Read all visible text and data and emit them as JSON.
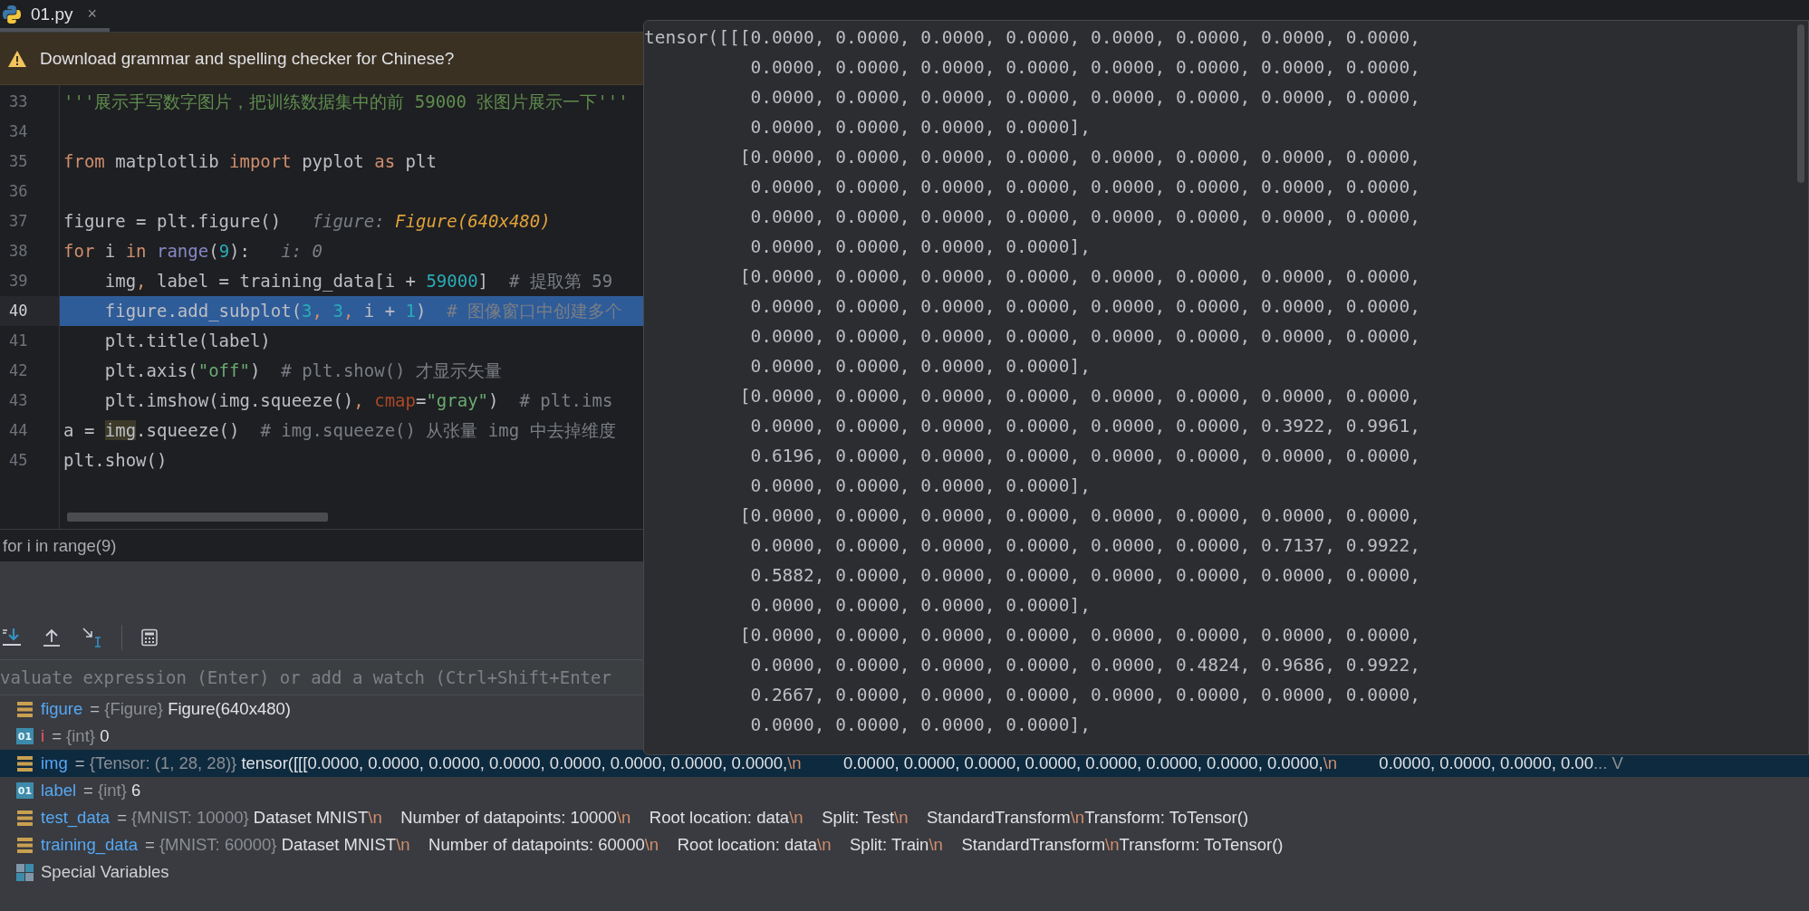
{
  "tab": {
    "title": "01.py",
    "close": "×",
    "selected": true
  },
  "banner": {
    "text": "Download grammar and spelling checker for Chinese?"
  },
  "editor": {
    "lines": [
      {
        "number": "33",
        "current": false,
        "tokens": [
          {
            "text": "'''展示手写数字图片，把训练数据集中的前 59000 张图片展示一下'''",
            "kind": "docstring"
          }
        ]
      },
      {
        "number": "34",
        "current": false
      },
      {
        "number": "35",
        "current": false,
        "tokens": [
          {
            "text": "from",
            "kind": "keyword"
          },
          {
            "text": " matplotlib ",
            "kind": "plain"
          },
          {
            "text": "import",
            "kind": "keyword"
          },
          {
            "text": " pyplot ",
            "kind": "plain"
          },
          {
            "text": "as",
            "kind": "keyword"
          },
          {
            "text": " plt",
            "kind": "plain"
          }
        ]
      },
      {
        "number": "36",
        "current": false
      },
      {
        "number": "37",
        "current": false,
        "tokens": [
          {
            "text": "figure = plt.figure()",
            "kind": "plain"
          },
          {
            "text": "   figure: ",
            "kind": "hint"
          },
          {
            "text": "Figure(640x480)",
            "kind": "hint_value"
          }
        ]
      },
      {
        "number": "38",
        "current": false,
        "tokens": [
          {
            "text": "for",
            "kind": "keyword"
          },
          {
            "text": " i ",
            "kind": "plain"
          },
          {
            "text": "in",
            "kind": "keyword"
          },
          {
            "text": " range",
            "kind": "builtin"
          },
          {
            "text": "(",
            "kind": "plain"
          },
          {
            "text": "9",
            "kind": "number"
          },
          {
            "text": "):",
            "kind": "plain"
          },
          {
            "text": "   i: 0",
            "kind": "hint"
          }
        ]
      },
      {
        "number": "39",
        "current": false,
        "tokens": [
          {
            "text": "    img",
            "kind": "plain"
          },
          {
            "text": ",",
            "kind": "keyword"
          },
          {
            "text": " label = training_data[i + ",
            "kind": "plain"
          },
          {
            "text": "59000",
            "kind": "number"
          },
          {
            "text": "]  ",
            "kind": "plain"
          },
          {
            "text": "# 提取第 59",
            "kind": "comment"
          }
        ]
      },
      {
        "number": "40",
        "current": true,
        "tokens": [
          {
            "text": "    figure.add_subplot(",
            "kind": "plain"
          },
          {
            "text": "3",
            "kind": "number"
          },
          {
            "text": ", ",
            "kind": "keyword"
          },
          {
            "text": "3",
            "kind": "number"
          },
          {
            "text": ",",
            "kind": "keyword"
          },
          {
            "text": " i + ",
            "kind": "plain"
          },
          {
            "text": "1",
            "kind": "number"
          },
          {
            "text": ")  ",
            "kind": "plain"
          },
          {
            "text": "# 图像窗口中创建多个",
            "kind": "comment"
          }
        ]
      },
      {
        "number": "41",
        "current": false,
        "tokens": [
          {
            "text": "    plt.title(label)",
            "kind": "plain"
          }
        ]
      },
      {
        "number": "42",
        "current": false,
        "tokens": [
          {
            "text": "    plt.axis(",
            "kind": "plain"
          },
          {
            "text": "\"off\"",
            "kind": "string"
          },
          {
            "text": ")  ",
            "kind": "plain"
          },
          {
            "text": "# plt.show() 才显示矢量",
            "kind": "comment"
          }
        ]
      },
      {
        "number": "43",
        "current": false,
        "tokens": [
          {
            "text": "    plt.imshow(img.squeeze()",
            "kind": "plain"
          },
          {
            "text": ",",
            "kind": "keyword"
          },
          {
            "text": " cmap",
            "kind": "param"
          },
          {
            "text": "=",
            "kind": "plain"
          },
          {
            "text": "\"gray\"",
            "kind": "string"
          },
          {
            "text": ")  ",
            "kind": "plain"
          },
          {
            "text": "# plt.ims",
            "kind": "comment"
          }
        ]
      },
      {
        "number": "44",
        "current": false,
        "tokens": [
          {
            "text": "a = ",
            "kind": "plain"
          },
          {
            "text": "img",
            "kind": "usage"
          },
          {
            "text": ".squeeze()  ",
            "kind": "plain"
          },
          {
            "text": "# img.squeeze() 从张量 img 中去掉维度",
            "kind": "comment"
          }
        ]
      },
      {
        "number": "45",
        "current": false,
        "tokens": [
          {
            "text": "plt.show()",
            "kind": "plain"
          }
        ]
      }
    ]
  },
  "breadcrumb": "for i in range(9)",
  "watch_field": {
    "placeholder": "valuate expression (Enter) or add a watch (Ctrl+Shift+Enter"
  },
  "variables": [
    {
      "kind": "object",
      "name": "figure",
      "equals": "=",
      "changed": false,
      "selected": false,
      "type": "{Figure}",
      "value": [
        {
          "text": "Figure(640x480)",
          "kind": "text"
        }
      ]
    },
    {
      "kind": "int",
      "badge": "01",
      "name": "i",
      "equals": "=",
      "changed": true,
      "selected": false,
      "type": "{int}",
      "value": [
        {
          "text": "0",
          "kind": "text"
        }
      ]
    },
    {
      "kind": "object",
      "name": "img",
      "equals": "=",
      "changed": false,
      "selected": true,
      "type": "{Tensor: (1, 28, 28)}",
      "value": [
        {
          "text": "tensor([[[0.0000, 0.0000, 0.0000, 0.0000, 0.0000, 0.0000, 0.0000, 0.0000,",
          "kind": "text"
        },
        {
          "text": "\\n",
          "kind": "escape"
        },
        {
          "text": "         0.0000, 0.0000, 0.0000, 0.0000, 0.0000, 0.0000, 0.0000, 0.0000,",
          "kind": "text"
        },
        {
          "text": "\\n",
          "kind": "escape"
        },
        {
          "text": "         0.0000, 0.0000, 0.0000, 0.00",
          "kind": "text"
        },
        {
          "text": "... V",
          "kind": "more"
        }
      ]
    },
    {
      "kind": "int",
      "badge": "01",
      "name": "label",
      "equals": "=",
      "changed": false,
      "selected": false,
      "type": "{int}",
      "value": [
        {
          "text": "6",
          "kind": "text"
        }
      ]
    },
    {
      "kind": "object",
      "name": "test_data",
      "equals": "=",
      "changed": false,
      "selected": false,
      "type": "{MNIST: 10000}",
      "value": [
        {
          "text": "Dataset MNIST",
          "kind": "text"
        },
        {
          "text": "\\n",
          "kind": "escape"
        },
        {
          "text": "    Number of datapoints: 10000",
          "kind": "text"
        },
        {
          "text": "\\n",
          "kind": "escape"
        },
        {
          "text": "    Root location: data",
          "kind": "text"
        },
        {
          "text": "\\n",
          "kind": "escape"
        },
        {
          "text": "    Split: Test",
          "kind": "text"
        },
        {
          "text": "\\n",
          "kind": "escape"
        },
        {
          "text": "    StandardTransform",
          "kind": "text"
        },
        {
          "text": "\\n",
          "kind": "escape"
        },
        {
          "text": "Transform: ToTensor()",
          "kind": "text"
        }
      ]
    },
    {
      "kind": "object",
      "name": "training_data",
      "equals": "=",
      "changed": false,
      "selected": false,
      "type": "{MNIST: 60000}",
      "value": [
        {
          "text": "Dataset MNIST",
          "kind": "text"
        },
        {
          "text": "\\n",
          "kind": "escape"
        },
        {
          "text": "    Number of datapoints: 60000",
          "kind": "text"
        },
        {
          "text": "\\n",
          "kind": "escape"
        },
        {
          "text": "    Root location: data",
          "kind": "text"
        },
        {
          "text": "\\n",
          "kind": "escape"
        },
        {
          "text": "    Split: Train",
          "kind": "text"
        },
        {
          "text": "\\n",
          "kind": "escape"
        },
        {
          "text": "    StandardTransform",
          "kind": "text"
        },
        {
          "text": "\\n",
          "kind": "escape"
        },
        {
          "text": "Transform: ToTensor()",
          "kind": "text"
        }
      ]
    },
    {
      "kind": "special",
      "name": "Special Variables",
      "selected": false
    }
  ],
  "value_popup": {
    "lines": [
      "tensor([[[0.0000, 0.0000, 0.0000, 0.0000, 0.0000, 0.0000, 0.0000, 0.0000,",
      "          0.0000, 0.0000, 0.0000, 0.0000, 0.0000, 0.0000, 0.0000, 0.0000,",
      "          0.0000, 0.0000, 0.0000, 0.0000, 0.0000, 0.0000, 0.0000, 0.0000,",
      "          0.0000, 0.0000, 0.0000, 0.0000],",
      "         [0.0000, 0.0000, 0.0000, 0.0000, 0.0000, 0.0000, 0.0000, 0.0000,",
      "          0.0000, 0.0000, 0.0000, 0.0000, 0.0000, 0.0000, 0.0000, 0.0000,",
      "          0.0000, 0.0000, 0.0000, 0.0000, 0.0000, 0.0000, 0.0000, 0.0000,",
      "          0.0000, 0.0000, 0.0000, 0.0000],",
      "         [0.0000, 0.0000, 0.0000, 0.0000, 0.0000, 0.0000, 0.0000, 0.0000,",
      "          0.0000, 0.0000, 0.0000, 0.0000, 0.0000, 0.0000, 0.0000, 0.0000,",
      "          0.0000, 0.0000, 0.0000, 0.0000, 0.0000, 0.0000, 0.0000, 0.0000,",
      "          0.0000, 0.0000, 0.0000, 0.0000],",
      "         [0.0000, 0.0000, 0.0000, 0.0000, 0.0000, 0.0000, 0.0000, 0.0000,",
      "          0.0000, 0.0000, 0.0000, 0.0000, 0.0000, 0.0000, 0.3922, 0.9961,",
      "          0.6196, 0.0000, 0.0000, 0.0000, 0.0000, 0.0000, 0.0000, 0.0000,",
      "          0.0000, 0.0000, 0.0000, 0.0000],",
      "         [0.0000, 0.0000, 0.0000, 0.0000, 0.0000, 0.0000, 0.0000, 0.0000,",
      "          0.0000, 0.0000, 0.0000, 0.0000, 0.0000, 0.0000, 0.7137, 0.9922,",
      "          0.5882, 0.0000, 0.0000, 0.0000, 0.0000, 0.0000, 0.0000, 0.0000,",
      "          0.0000, 0.0000, 0.0000, 0.0000],",
      "         [0.0000, 0.0000, 0.0000, 0.0000, 0.0000, 0.0000, 0.0000, 0.0000,",
      "          0.0000, 0.0000, 0.0000, 0.0000, 0.0000, 0.4824, 0.9686, 0.9922,",
      "          0.2667, 0.0000, 0.0000, 0.0000, 0.0000, 0.0000, 0.0000, 0.0000,",
      "          0.0000, 0.0000, 0.0000, 0.0000],"
    ]
  }
}
